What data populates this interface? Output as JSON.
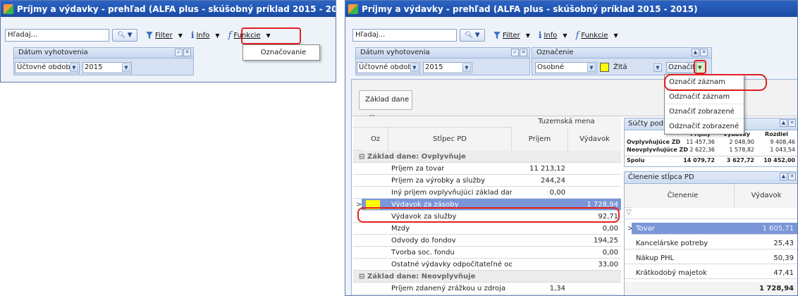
{
  "window_title": "Príjmy a výdavky - prehľad (ALFA plus - skúšobný príklad 2015 - 2015)",
  "colors": {
    "title_bar": "#1f56b8",
    "selected_row": "#7b96d8",
    "highlight_box": "#e02020",
    "mark_yellow": "#ffff00"
  },
  "toolbar": {
    "search_placeholder": "Hľadaj...",
    "filter_label": "Filter",
    "info_label": "Info",
    "functions_label": "Funkcie",
    "icons": [
      "search-icon",
      "filter-icon",
      "info-icon",
      "function-icon"
    ]
  },
  "left": {
    "functions_menu_item": "Označovanie",
    "panel_title": "Dátum vyhotovenia",
    "period_select": "Účtovné obdobie",
    "year_select": "2015"
  },
  "right": {
    "date_panel_title": "Dátum vyhotovenia",
    "period_select": "Účtovné obdobie",
    "year_select": "2015",
    "mark_panel_title": "Označenie",
    "mark_type_select": "Osobné",
    "color_label": "Žltá",
    "mark_button": "Označiť",
    "mark_menu": [
      "Označiť záznam",
      "Odznačiť záznam",
      "Označiť zobrazené",
      "Odznačiť zobrazené"
    ]
  },
  "group_chip": "Základ dane",
  "main_grid": {
    "band_header": "Tuzemská mena",
    "columns": [
      "Oz",
      "Stĺpec PD",
      "Príjem",
      "Výdavok"
    ],
    "rows": [
      {
        "type": "group",
        "label": "Základ dane: Ovplyvňuje"
      },
      {
        "label": "Príjem za tovar",
        "prijem": "11 213,12",
        "vydavok": ""
      },
      {
        "label": "Príjem za výrobky a služby",
        "prijem": "244,24",
        "vydavok": ""
      },
      {
        "label": "Iný príjem ovplyvňujúci základ dane",
        "prijem": "0,00",
        "vydavok": ""
      },
      {
        "label": "Výdavok za zásoby",
        "prijem": "",
        "vydavok": "1 728,94",
        "selected": true
      },
      {
        "label": "Výdavok za služby",
        "prijem": "",
        "vydavok": "92,71"
      },
      {
        "label": "Mzdy",
        "prijem": "",
        "vydavok": "0,00"
      },
      {
        "label": "Odvody do fondov",
        "prijem": "",
        "vydavok": "194,25"
      },
      {
        "label": "Tvorba soc. fondu",
        "prijem": "",
        "vydavok": "0,00"
      },
      {
        "label": "Ostatné výdavky odpočítateľné od základu dane",
        "prijem": "",
        "vydavok": "33,00"
      },
      {
        "type": "group",
        "label": "Základ dane: Neovplyvňuje"
      },
      {
        "label": "Príjem zdanený zrážkou u zdroja",
        "prijem": "1,34",
        "vydavok": ""
      }
    ]
  },
  "sums_panel": {
    "title": "Súčty podľa",
    "columns": [
      "Príjmy",
      "Výdavky",
      "Rozdiel"
    ],
    "rows": [
      {
        "label": "Ovplyvňujúce ZD",
        "prijmy": "11 457,36",
        "vydavky": "2 048,90",
        "rozdiel": "9 408,46"
      },
      {
        "label": "Neovplyvňujúce ZD",
        "prijmy": "2 622,36",
        "vydavky": "1 578,82",
        "rozdiel": "1 043,54"
      },
      {
        "label": "Spolu",
        "prijmy": "14 079,72",
        "vydavky": "3 627,72",
        "rozdiel": "10 452,00"
      }
    ]
  },
  "breakdown_panel": {
    "title": "Členenie stĺpca PD",
    "columns": [
      "Členenie",
      "Výdavok"
    ],
    "rows": [
      {
        "label": "Tovar",
        "value": "1 605,71",
        "selected": true
      },
      {
        "label": "Kancelárske potreby",
        "value": "25,43"
      },
      {
        "label": "Nákup PHL",
        "value": "50,39"
      },
      {
        "label": "Krátkodobý majetok",
        "value": "47,41"
      }
    ],
    "total": "1 728,94"
  }
}
